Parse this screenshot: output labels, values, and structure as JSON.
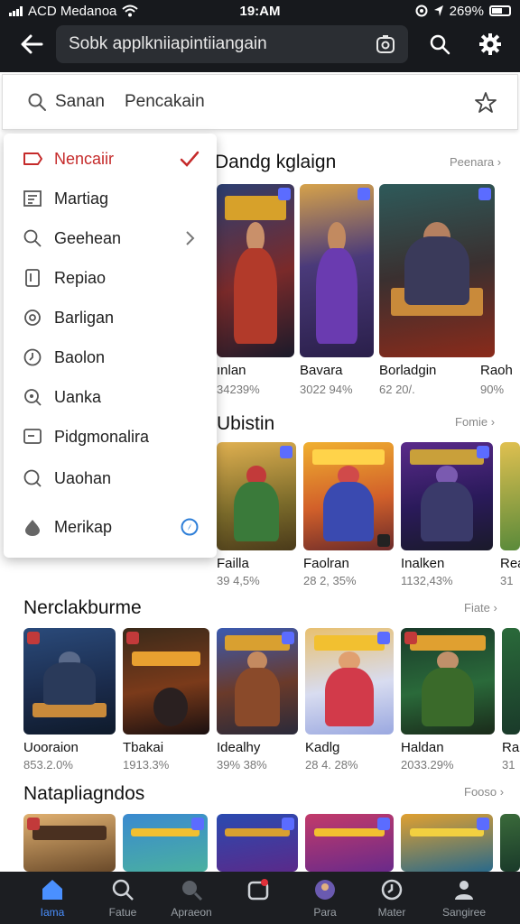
{
  "status": {
    "carrier": "ACD Medanoa",
    "time": "19:AM",
    "battery": "269%",
    "battery_level": 0.6
  },
  "topbar": {
    "search_text": "Sobk applkniiapintiiangain",
    "icons": [
      "back-arrow-icon",
      "lens-icon",
      "search-icon",
      "gear-icon"
    ]
  },
  "search_bar": {
    "text_1": "Sanan",
    "text_2": "Pencakain",
    "icons": [
      "search-icon",
      "star-icon"
    ]
  },
  "menu": {
    "items": [
      {
        "label": "Nencaiir",
        "icon": "tag-icon",
        "active": true,
        "trail": "check-icon"
      },
      {
        "label": "Martiag",
        "icon": "list-icon"
      },
      {
        "label": "Geehean",
        "icon": "search-icon",
        "trail": "chevron-right-icon"
      },
      {
        "label": "Repiao",
        "icon": "bookmark-icon"
      },
      {
        "label": "Barligan",
        "icon": "refresh-icon"
      },
      {
        "label": "Baolon",
        "icon": "clock-icon"
      },
      {
        "label": "Uanka",
        "icon": "zoom-icon"
      },
      {
        "label": "Pidgmonalira",
        "icon": "message-icon"
      },
      {
        "label": "Uaohan",
        "icon": "timer-icon"
      },
      {
        "label": "Merikap",
        "icon": "drop-icon",
        "trail": "compass-icon"
      }
    ]
  },
  "sections": [
    {
      "title": "Dandg kglaign",
      "link": "Peenara",
      "cards": [
        {
          "name": "ınlan",
          "stat": "34239%"
        },
        {
          "name": "Bavara",
          "stat": "3022 94%"
        },
        {
          "name": "Borladgin",
          "stat": "62 20/."
        },
        {
          "name": "Raoh",
          "stat": "90%"
        }
      ]
    },
    {
      "title": "Ubistin",
      "link": "Fomie",
      "cards": [
        {
          "name": "Failla",
          "stat": "39 4,5%"
        },
        {
          "name": "Faolran",
          "stat": "28 2, 35%"
        },
        {
          "name": "Inalken",
          "stat": "1132,43%"
        },
        {
          "name": "Rea",
          "stat": "31"
        }
      ]
    },
    {
      "title": "Nerclakburme",
      "link": "Fiate",
      "cards": [
        {
          "name": "Uooraion",
          "stat": "853.2.0%"
        },
        {
          "name": "Tbakai",
          "stat": "1913.3%"
        },
        {
          "name": "Idealhy",
          "stat": "39% 38%"
        },
        {
          "name": "Kadlg",
          "stat": "28 4. 28%"
        },
        {
          "name": "Haldan",
          "stat": "2033.29%"
        },
        {
          "name": "Rar",
          "stat": "31"
        }
      ]
    },
    {
      "title": "Natapliagndos",
      "link": "Fooso"
    }
  ],
  "bottom_nav": [
    {
      "label": "Iama",
      "icon": "home-icon",
      "active": true
    },
    {
      "label": "Fatue",
      "icon": "search-icon"
    },
    {
      "label": "Apraeon",
      "icon": "lens-icon"
    },
    {
      "label": "",
      "icon": "bell-icon"
    },
    {
      "label": "Para",
      "icon": "avatar-icon"
    },
    {
      "label": "Mater",
      "icon": "clock-icon"
    },
    {
      "label": "Sangiree",
      "icon": "profile-icon"
    }
  ],
  "colors": {
    "topbar": "#17191d",
    "accent_red": "#c52a2a",
    "nav_active": "#4a90ff",
    "nav_bg": "#1c1e22"
  }
}
